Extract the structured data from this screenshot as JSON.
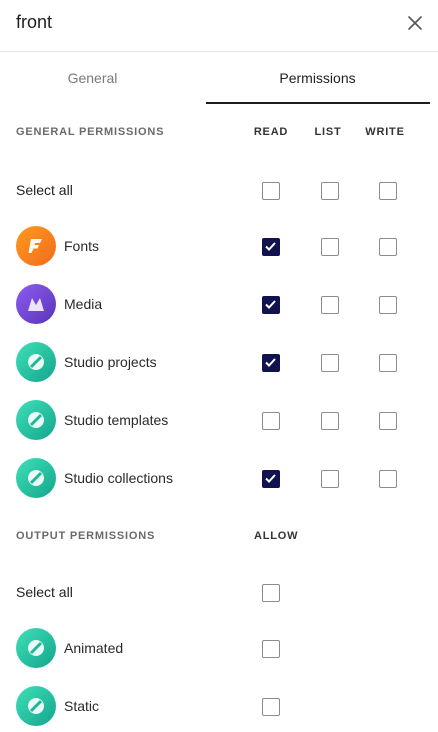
{
  "window": {
    "title": "front"
  },
  "tabs": [
    {
      "label": "General",
      "active": false
    },
    {
      "label": "Permissions",
      "active": true
    }
  ],
  "general_permissions": {
    "section_label": "GENERAL PERMISSIONS",
    "columns": [
      "READ",
      "LIST",
      "WRITE"
    ],
    "select_all_label": "Select all",
    "rows": [
      {
        "label": "Fonts",
        "icon": "fonts-app-icon",
        "read": true,
        "list": false,
        "write": false
      },
      {
        "label": "Media",
        "icon": "media-app-icon",
        "read": true,
        "list": false,
        "write": false
      },
      {
        "label": "Studio projects",
        "icon": "studio-app-icon",
        "read": true,
        "list": false,
        "write": false
      },
      {
        "label": "Studio templates",
        "icon": "studio-app-icon",
        "read": false,
        "list": false,
        "write": false
      },
      {
        "label": "Studio collections",
        "icon": "studio-app-icon",
        "read": true,
        "list": false,
        "write": false
      }
    ]
  },
  "output_permissions": {
    "section_label": "OUTPUT PERMISSIONS",
    "column": "ALLOW",
    "select_all_label": "Select all",
    "rows": [
      {
        "label": "Animated",
        "icon": "studio-app-icon",
        "allow": false
      },
      {
        "label": "Static",
        "icon": "studio-app-icon",
        "allow": false
      }
    ]
  },
  "colors": {
    "checkbox_checked": "#12124f",
    "fonts_icon": "#f57c1f",
    "media_icon": "#7448d8",
    "studio_icon": "#22c3a0"
  }
}
